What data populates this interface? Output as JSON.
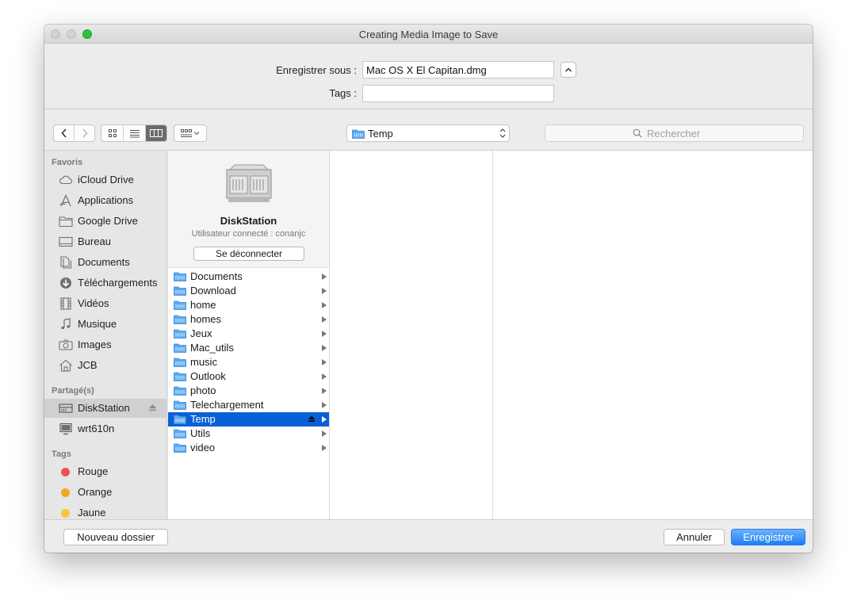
{
  "window": {
    "title": "Creating Media Image to Save"
  },
  "form": {
    "save_as_label": "Enregistrer sous :",
    "save_as_value": "Mac OS X El Capitan.dmg",
    "tags_label": "Tags :",
    "tags_value": ""
  },
  "toolbar": {
    "back_icon": "chevron-left-icon",
    "forward_icon": "chevron-right-icon",
    "view_modes": [
      "icon-view",
      "list-view",
      "column-view"
    ],
    "active_view": "column-view",
    "group_icon": "group-by-icon",
    "path_current": "Temp",
    "search_placeholder": "Rechercher"
  },
  "sidebar": {
    "favorites_title": "Favoris",
    "favorites": [
      {
        "label": "iCloud Drive",
        "icon": "cloud-icon"
      },
      {
        "label": "Applications",
        "icon": "applications-icon"
      },
      {
        "label": "Google Drive",
        "icon": "folder-icon"
      },
      {
        "label": "Bureau",
        "icon": "desktop-icon"
      },
      {
        "label": "Documents",
        "icon": "documents-icon"
      },
      {
        "label": "Téléchargements",
        "icon": "download-icon"
      },
      {
        "label": "Vidéos",
        "icon": "film-icon"
      },
      {
        "label": "Musique",
        "icon": "music-icon"
      },
      {
        "label": "Images",
        "icon": "camera-icon"
      },
      {
        "label": "JCB",
        "icon": "home-icon"
      }
    ],
    "shared_title": "Partagé(s)",
    "shared": [
      {
        "label": "DiskStation",
        "icon": "server-icon",
        "selected": true
      },
      {
        "label": "wrt610n",
        "icon": "monitor-icon",
        "selected": false
      }
    ],
    "tags_title": "Tags",
    "tags": [
      {
        "label": "Rouge",
        "color": "#ef5350"
      },
      {
        "label": "Orange",
        "color": "#f5a623"
      },
      {
        "label": "Jaune",
        "color": "#f7c53b"
      }
    ]
  },
  "server": {
    "name": "DiskStation",
    "user": "Utilisateur connecté : conanjc",
    "disconnect_label": "Se déconnecter"
  },
  "folders": [
    {
      "label": "Documents"
    },
    {
      "label": "Download"
    },
    {
      "label": "home"
    },
    {
      "label": "homes"
    },
    {
      "label": "Jeux"
    },
    {
      "label": "Mac_utils"
    },
    {
      "label": "music"
    },
    {
      "label": "Outlook"
    },
    {
      "label": "photo"
    },
    {
      "label": "Telechargement"
    },
    {
      "label": "Temp",
      "selected": true
    },
    {
      "label": "Utils"
    },
    {
      "label": "video"
    }
  ],
  "buttons": {
    "new_folder": "Nouveau dossier",
    "cancel": "Annuler",
    "save": "Enregistrer"
  },
  "colors": {
    "accent": "#0a60d6",
    "folder": "#5aaaf0"
  }
}
